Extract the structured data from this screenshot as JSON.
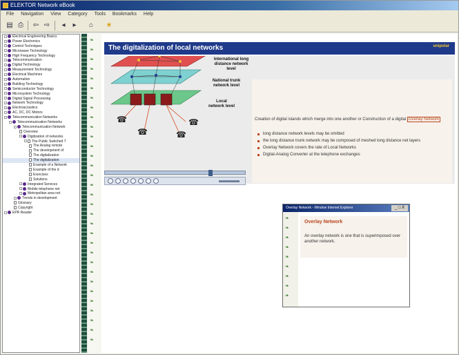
{
  "window": {
    "title": "ELEKTOR Network eBook",
    "menu": [
      "File",
      "Navigation",
      "View",
      "Category",
      "Tools",
      "Bookmarks",
      "Help"
    ]
  },
  "toolbar": {
    "icons": [
      "contents-icon",
      "print-icon",
      "back-icon",
      "forward-icon",
      "prev-icon",
      "next-icon",
      "home-icon",
      "bookmark-icon"
    ]
  },
  "tree": {
    "items": [
      "Electrical Engineering Basics",
      "Power Electronics",
      "Control Techniques",
      "Microwave Technology",
      "High Frequency Technology",
      "Telecommunication",
      "Digital Technology",
      "Measurement Technology",
      "Electrical Machines",
      "Automation",
      "Building Technology",
      "Semiconductor Technology",
      "Microsystem Technology",
      "Digital Signal Processing",
      "Network Technology",
      "Electroacoustics",
      "AC, DC, DC Motors",
      "Telecommunication Networks",
      "Telecommunication Networks",
      "Telecommunication Network",
      "Overview",
      "Digitization of networks",
      "The Public Switched T",
      "The Analog remote",
      "The development of",
      "The digitalization",
      "The digitalization",
      "Example of a Network",
      "Example of the d",
      "Exercises",
      "Solutions",
      "Integrated Services",
      "Mobile telephone net",
      "Metropolitan area net",
      "Trends in development",
      "Glossary",
      "Copyright",
      "EPR Reader"
    ]
  },
  "content": {
    "title": "The digitalization of local networks",
    "logo": "unipolar",
    "layers": {
      "top": "International long distance network level",
      "middle": "National trunk network level",
      "bottom": "Local network level"
    },
    "lead_pre": "Creation of digital islands which merge into one another or Construction of a digital",
    "lead_highlight": "Overlay Network",
    "bullets": [
      "long distance network levels may be omitted",
      "the long distance trunk network may be composed of meshed long distance net layers",
      "Overlay Network covers the rate of Local Networks",
      "Digital-Analog Converter at the telephone exchanges"
    ]
  },
  "popup": {
    "title": "Overlay Network - Window Internet Explorer",
    "close_label": "_ □ X",
    "heading": "Overlay Network",
    "text": "An overlay network is one that is superimposed over another network."
  },
  "colors": {
    "banner": "#1f3a8a",
    "accent": "#b9471e",
    "top_layer": "#e05050",
    "mid_layer": "#7fd0d0",
    "low_layer": "#6cc78a"
  }
}
